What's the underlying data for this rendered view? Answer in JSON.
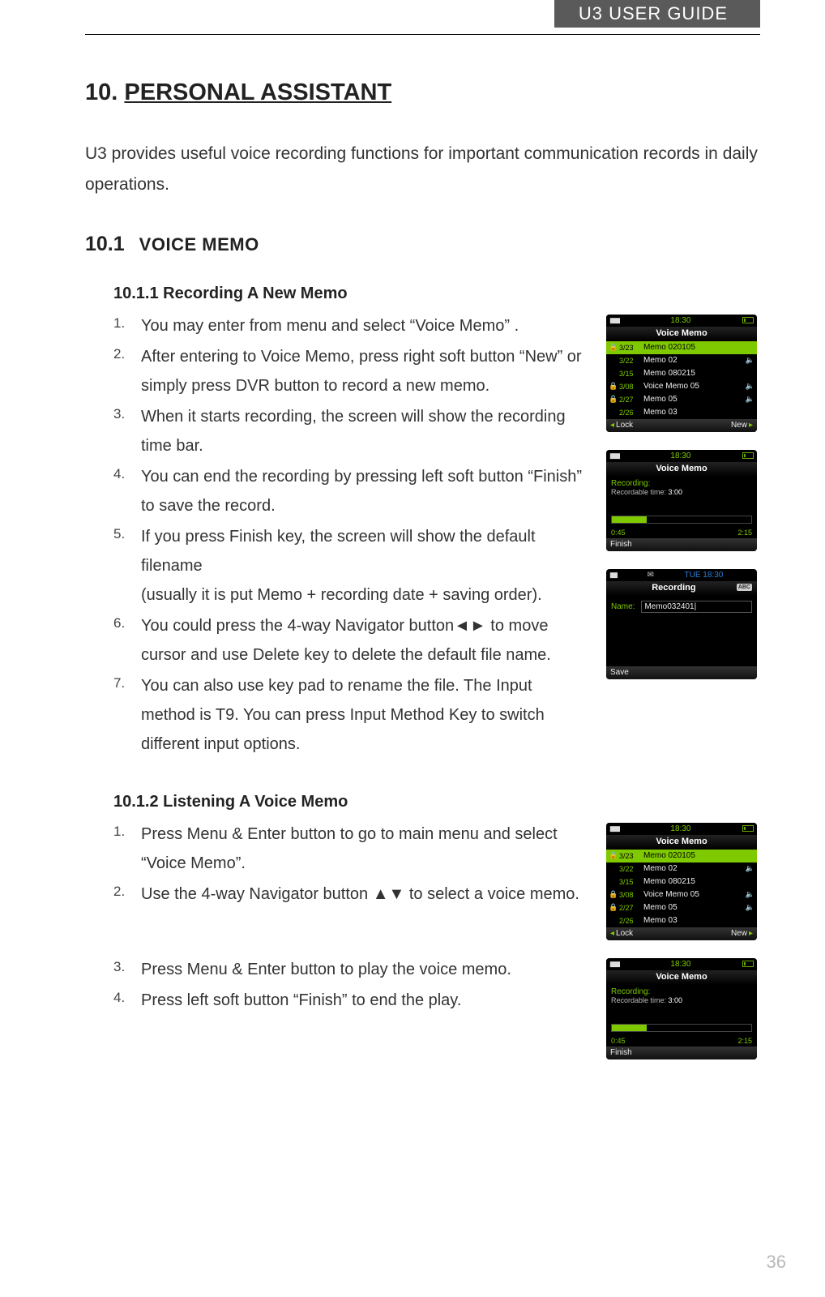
{
  "header": {
    "title": "U3 USER GUIDE"
  },
  "page_number": "36",
  "h1": {
    "num": "10.",
    "text": "PERSONAL ASSISTANT"
  },
  "intro": "U3 provides useful voice recording functions for important communication records in daily operations.",
  "h2": {
    "num": "10.1",
    "text": "VOICE MEMO"
  },
  "s1": {
    "h3": "10.1.1  Recording A New Memo",
    "steps": [
      "You may enter from menu and select “Voice Memo” .",
      "After entering to Voice Memo, press right soft button “New” or simply press DVR button to record a new memo.",
      "When it starts recording, the screen will show the recording time bar.",
      "You can end the recording by pressing left soft button “Finish” to save the record.",
      "If you press Finish key, the screen will show the default filename",
      "You could press the 4-way Navigator button◄► to move cursor and use Delete key to delete the default file name.",
      "You can also use key pad to rename the file. The Input method is T9. You can press Input Method Key to switch different input options."
    ],
    "step5_sub": "(usually it is put Memo + recording date + saving order)."
  },
  "s2": {
    "h3": "10.1.2  Listening A Voice Memo",
    "stepsA": [
      "Press Menu & Enter button to go to main menu and select “Voice Memo”.",
      "Use the 4-way Navigator button ▲▼ to select a voice memo."
    ],
    "stepsB": [
      "Press Menu & Enter button to play the voice memo.",
      "Press left soft button “Finish” to end the play."
    ]
  },
  "phone_list": {
    "time": "18:30",
    "title": "Voice Memo",
    "softL": "Lock",
    "softR": "New",
    "rows": [
      {
        "lock": "🔒",
        "date": "3/23",
        "name": "Memo 020105",
        "spk": "",
        "sel": true
      },
      {
        "lock": "",
        "date": "3/22",
        "name": "Memo 02",
        "spk": "🔈",
        "sel": false
      },
      {
        "lock": "",
        "date": "3/15",
        "name": "Memo 080215",
        "spk": "",
        "sel": false
      },
      {
        "lock": "🔒",
        "date": "3/08",
        "name": "Voice Memo 05",
        "spk": "🔈",
        "sel": false
      },
      {
        "lock": "🔒",
        "date": "2/27",
        "name": "Memo 05",
        "spk": "🔈",
        "sel": false
      },
      {
        "lock": "",
        "date": "2/26",
        "name": "Memo 03",
        "spk": "",
        "sel": false
      }
    ]
  },
  "phone_rec": {
    "time": "18:30",
    "title": "Voice Memo",
    "recording": "Recording:",
    "rectime_label": "Recordable time: ",
    "rectime_val": "3:00",
    "elapsed": "0:45",
    "remain": "2:15",
    "fill_pct": "25%",
    "softL": "Finish"
  },
  "phone_name": {
    "day": "TUE 18:30",
    "title": "Recording",
    "abc": "ABC",
    "name_label": "Name:",
    "name_value": "Memo032401|",
    "softL": "Save"
  }
}
